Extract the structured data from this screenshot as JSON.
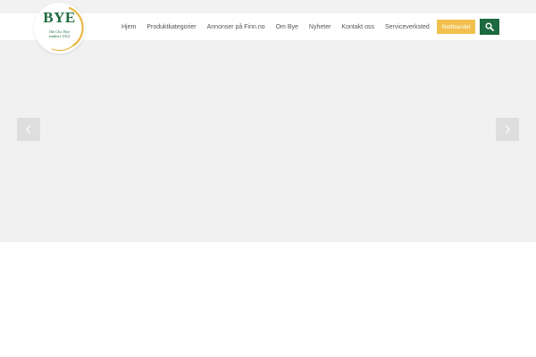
{
  "logo": {
    "name": "BYE",
    "line1": "Ole Chr. Bye",
    "line2": "etablert 1912",
    "color": "#1f6b3f",
    "ring_color": "#e9b743"
  },
  "nav": {
    "items": [
      {
        "label": "Hjem"
      },
      {
        "label": "Produktkategorier"
      },
      {
        "label": "Annonser på Finn.no"
      },
      {
        "label": "Om Bye"
      },
      {
        "label": "Nyheter"
      },
      {
        "label": "Kontakt oss"
      },
      {
        "label": "Serviceverksted"
      }
    ]
  },
  "shop_button": {
    "label": "Nettbandel",
    "color": "#f2c04e"
  },
  "search_button": {
    "icon": "search-icon",
    "color": "#1d6a40"
  },
  "slider": {
    "prev_icon": "chevron-left-icon",
    "next_icon": "chevron-right-icon"
  }
}
